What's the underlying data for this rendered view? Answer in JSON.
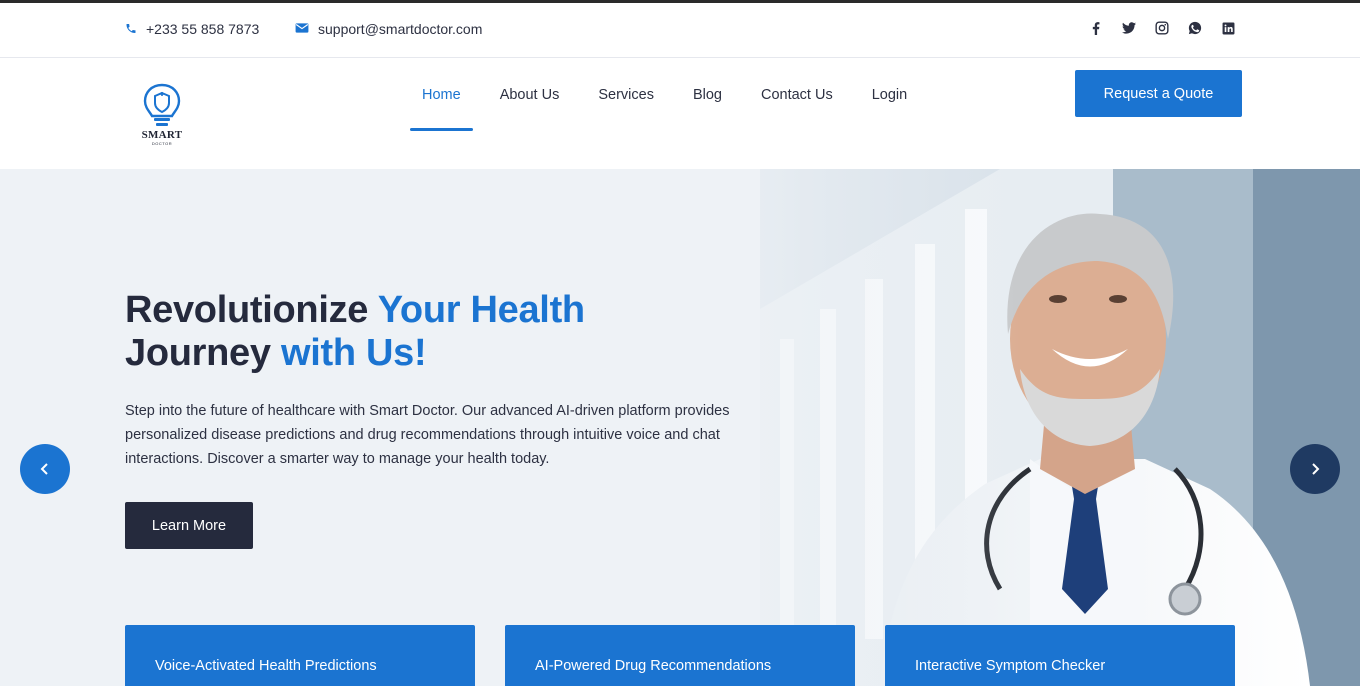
{
  "topbar": {
    "phone": "+233 55 858 7873",
    "email": "support@smartdoctor.com",
    "socials": [
      {
        "icon": "facebook-icon"
      },
      {
        "icon": "twitter-icon"
      },
      {
        "icon": "instagram-icon"
      },
      {
        "icon": "whatsapp-icon"
      },
      {
        "icon": "linkedin-icon"
      }
    ]
  },
  "brand": {
    "name": "SMART",
    "sub": "DOCTOR"
  },
  "nav": {
    "items": [
      "Home",
      "About Us",
      "Services",
      "Blog",
      "Contact Us",
      "Login"
    ],
    "active": "Home"
  },
  "header": {
    "quote_label": "Request a Quote"
  },
  "hero": {
    "title_dark_1": "Revolutionize ",
    "title_blue_1": "Your Health",
    "title_dark_2": "Journey ",
    "title_blue_2": "with Us!",
    "description": "Step into the future of healthcare with Smart Doctor. Our advanced AI-driven platform provides personalized disease predictions and drug recommendations through intuitive voice and chat interactions. Discover a smarter way to manage your health today.",
    "cta_label": "Learn More"
  },
  "features": [
    "Voice-Activated Health Predictions",
    "AI-Powered Drug Recommendations",
    "Interactive Symptom Checker"
  ],
  "colors": {
    "accent": "#1b74d1",
    "dark": "#252a3d",
    "next_arrow": "#1f3a62"
  }
}
